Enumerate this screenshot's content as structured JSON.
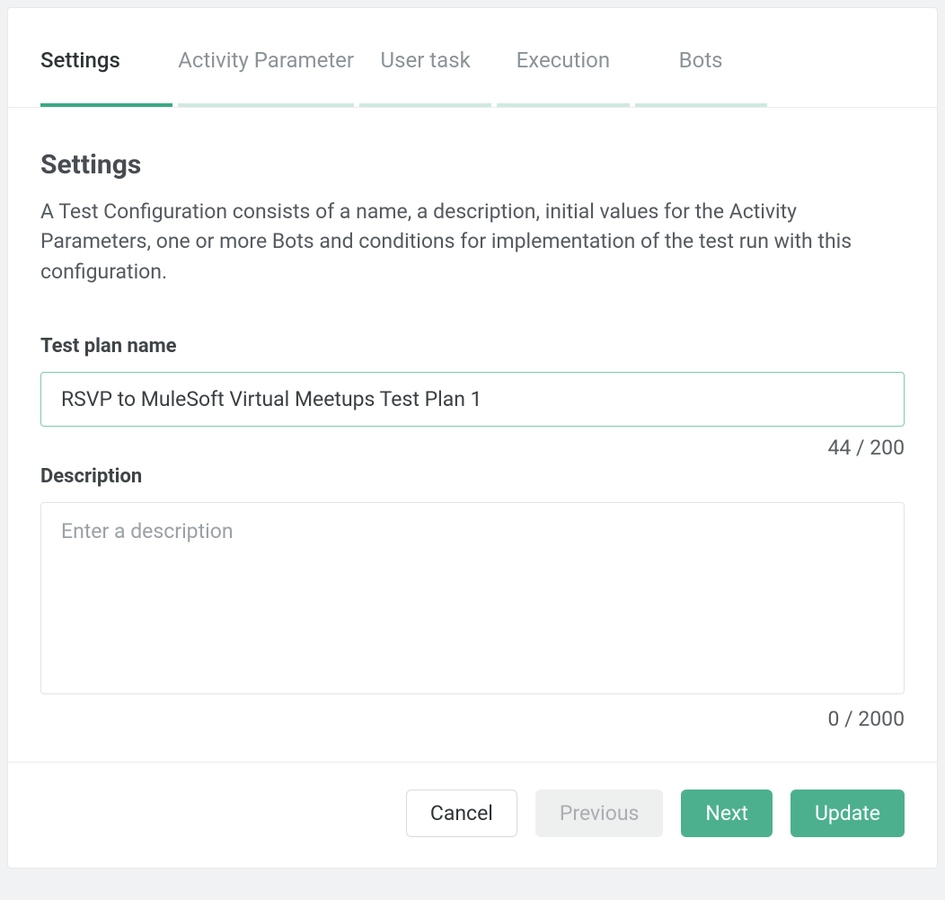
{
  "tabs": {
    "settings": "Settings",
    "activity_parameter": "Activity Parameter",
    "user_task": "User task",
    "execution": "Execution",
    "bots": "Bots"
  },
  "section": {
    "title": "Settings",
    "description": "A Test Configuration consists of a name, a description, initial values for the Activity Parameters, one or more Bots and conditions for implementation of the test run with this configuration."
  },
  "fields": {
    "name": {
      "label": "Test plan name",
      "value": "RSVP to MuleSoft Virtual Meetups Test Plan 1",
      "counter": "44 / 200"
    },
    "description": {
      "label": "Description",
      "placeholder": "Enter a description",
      "value": "",
      "counter": "0 / 2000"
    }
  },
  "buttons": {
    "cancel": "Cancel",
    "previous": "Previous",
    "next": "Next",
    "update": "Update"
  }
}
